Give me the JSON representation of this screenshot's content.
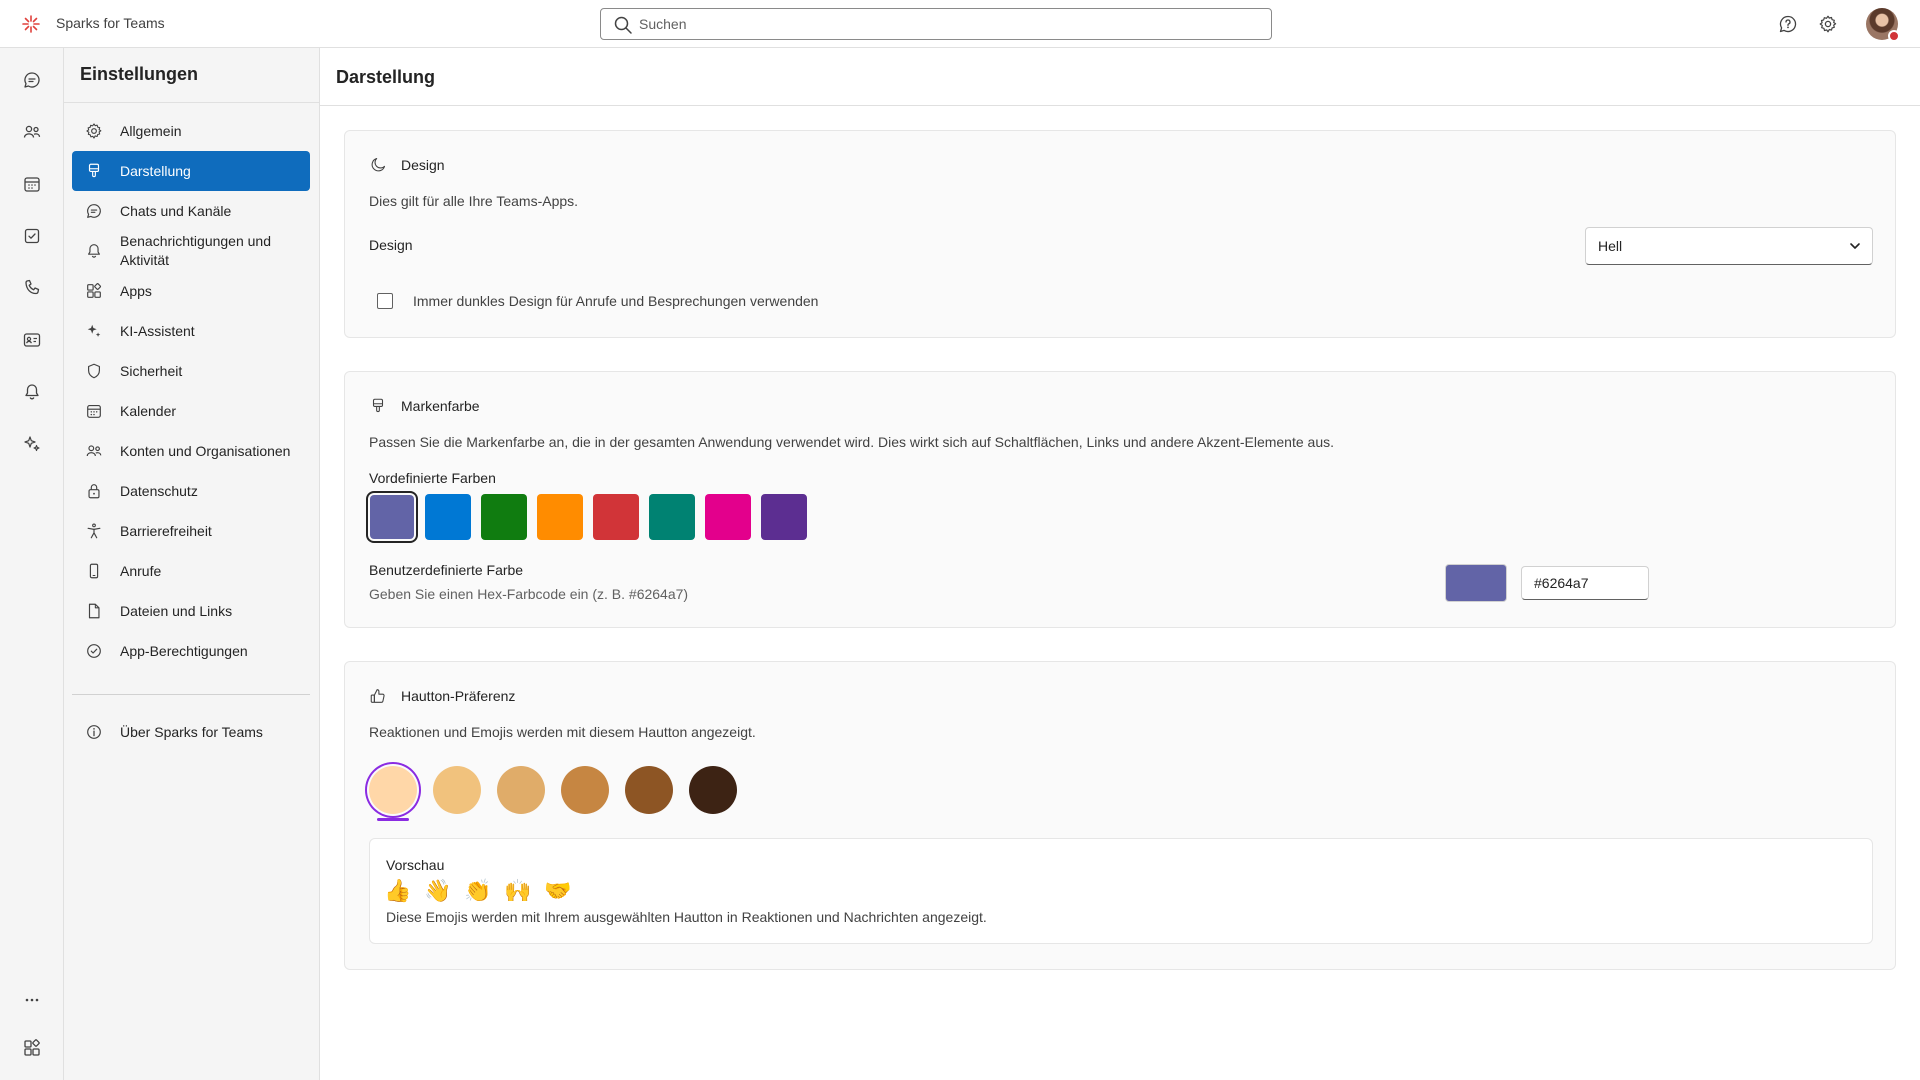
{
  "app": {
    "title": "Sparks for Teams"
  },
  "search": {
    "placeholder": "Suchen"
  },
  "settings_nav": {
    "title": "Einstellungen",
    "items": [
      {
        "label": "Allgemein",
        "icon": "gear-icon"
      },
      {
        "label": "Darstellung",
        "icon": "brush-icon",
        "active": true
      },
      {
        "label": "Chats und Kanäle",
        "icon": "chat-icon"
      },
      {
        "label": "Benachrichtigungen und Aktivität",
        "icon": "bell-icon"
      },
      {
        "label": "Apps",
        "icon": "apps-icon"
      },
      {
        "label": "KI-Assistent",
        "icon": "sparkle-icon"
      },
      {
        "label": "Sicherheit",
        "icon": "shield-icon"
      },
      {
        "label": "Kalender",
        "icon": "calendar-icon"
      },
      {
        "label": "Konten und Organisationen",
        "icon": "people-icon"
      },
      {
        "label": "Datenschutz",
        "icon": "lock-icon"
      },
      {
        "label": "Barrierefreiheit",
        "icon": "accessibility-icon"
      },
      {
        "label": "Anrufe",
        "icon": "phone-icon"
      },
      {
        "label": "Dateien und Links",
        "icon": "document-icon"
      },
      {
        "label": "App-Berechtigungen",
        "icon": "check-circle-icon"
      }
    ],
    "about": {
      "label": "Über Sparks for Teams",
      "icon": "info-icon"
    }
  },
  "main": {
    "title": "Darstellung"
  },
  "design_card": {
    "title": "Design",
    "description": "Dies gilt für alle Ihre Teams-Apps.",
    "field_label": "Design",
    "selected_value": "Hell",
    "checkbox_label": "Immer dunkles Design für Anrufe und Besprechungen verwenden",
    "checkbox_checked": false
  },
  "brand_card": {
    "title": "Markenfarbe",
    "description": "Passen Sie die Markenfarbe an, die in der gesamten Anwendung verwendet wird. Dies wirkt sich auf Schaltflächen, Links und andere Akzent-Elemente aus.",
    "predefined_label": "Vordefinierte Farben",
    "swatches": [
      "#6264a7",
      "#0078d4",
      "#107c10",
      "#ff8c00",
      "#d13438",
      "#008272",
      "#e3008c",
      "#5c2e91"
    ],
    "selected_swatch": "#6264a7",
    "custom_label": "Benutzerdefinierte Farbe",
    "custom_hint": "Geben Sie einen Hex-Farbcode ein (z. B. #6264a7)",
    "custom_value": "#6264a7"
  },
  "skin_card": {
    "title": "Hautton-Präferenz",
    "description": "Reaktionen und Emojis werden mit diesem Hautton angezeigt.",
    "tones": [
      "#ffd7a8",
      "#f1c27d",
      "#e0ac69",
      "#c68642",
      "#8d5524",
      "#3d2314"
    ],
    "selected_tone": "#ffd7a8",
    "preview_label": "Vorschau",
    "preview_emojis": [
      "👍",
      "👋",
      "👏",
      "🙌",
      "🤝"
    ],
    "preview_note": "Diese Emojis werden mit Ihrem ausgewählten Hautton in Reaktionen und Nachrichten angezeigt."
  },
  "colors": {
    "accent": "#0f6cbd",
    "brand": "#6264a7",
    "tone_ring": "#8a2be2",
    "status_busy": "#d13438"
  }
}
